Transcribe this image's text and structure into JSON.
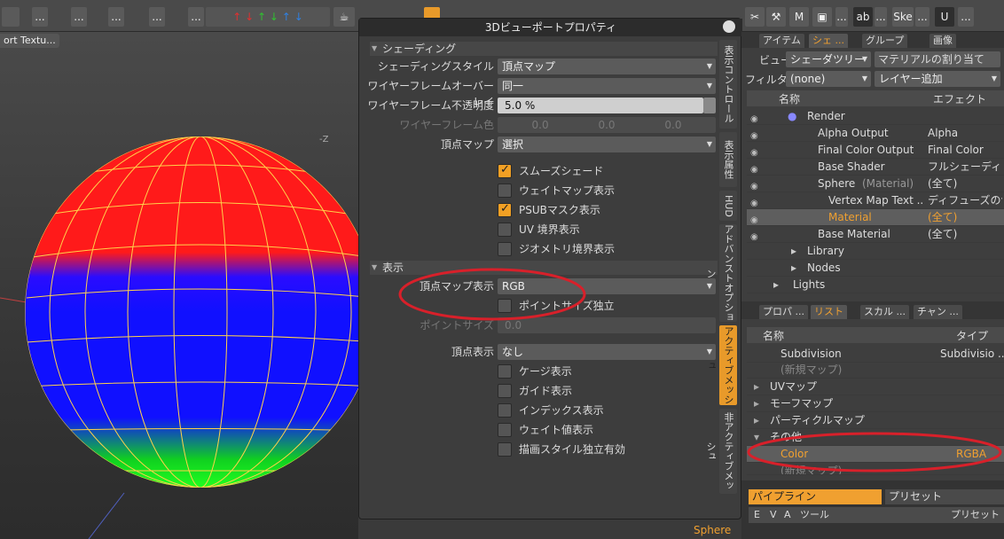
{
  "toolbar": {
    "items": [
      "...",
      "...",
      "...",
      "...",
      "...",
      "...",
      "...",
      "Ske",
      "..."
    ],
    "ab_label": "ab"
  },
  "viewport": {
    "label": "ort Textu...",
    "axis_label": "-Z",
    "status": "Sphere"
  },
  "dialog": {
    "title": "3Dビューポートプロパティ",
    "sec_shading": "シェーディング",
    "shading_style_label": "シェーディングスタイル",
    "shading_style_value": "頂点マップ",
    "wire_overlay_label": "ワイヤーフレームオーバーレイ",
    "wire_overlay_value": "同一",
    "wire_opacity_label": "ワイヤーフレーム不透明度",
    "wire_opacity_value": "5.0 %",
    "wire_color_label": "ワイヤーフレーム色",
    "wire_color_values": [
      "0.0",
      "0.0",
      "0.0"
    ],
    "vmap_label": "頂点マップ",
    "vmap_value": "選択",
    "checks": [
      {
        "label": "スムーズシェード",
        "checked": true
      },
      {
        "label": "ウェイトマップ表示",
        "checked": false
      },
      {
        "label": "PSUBマスク表示",
        "checked": true
      },
      {
        "label": "UV 境界表示",
        "checked": false
      },
      {
        "label": "ジオメトリ境界表示",
        "checked": false
      }
    ],
    "sec_display": "表示",
    "vmap_display_label": "頂点マップ表示",
    "vmap_display_value": "RGB",
    "point_size_indep": "ポイントサイズ独立",
    "point_size_label": "ポイントサイズ",
    "point_size_value": "0.0",
    "vertex_display_label": "頂点表示",
    "vertex_display_value": "なし",
    "checks2": [
      "ケージ表示",
      "ガイド表示",
      "インデックス表示",
      "ウェイト値表示",
      "描画スタイル独立有効"
    ],
    "side_tabs": [
      "表示コントロール",
      "表示属性",
      "HUD",
      "アドバンストオプション",
      "アクティブメッシュ",
      "非アクティブメッシュ"
    ]
  },
  "shader": {
    "tabs": [
      "アイテム",
      "シェ ...",
      "グループ",
      "画像"
    ],
    "view_label": "ビュー",
    "view_value": "シェーダツリー",
    "assign_btn": "マテリアルの割り当て",
    "filter_label": "フィルター",
    "filter_value": "(none)",
    "add_layer": "レイヤー追加",
    "col_name": "名称",
    "col_effect": "エフェクト",
    "rows": [
      {
        "name": "Render",
        "effect": ""
      },
      {
        "name": "Alpha Output",
        "effect": "Alpha"
      },
      {
        "name": "Final Color Output",
        "effect": "Final Color"
      },
      {
        "name": "Base Shader",
        "effect": "フルシェーディン..."
      },
      {
        "name": "Sphere",
        "suffix": "(Material)",
        "effect": "(全て)"
      },
      {
        "name": "Vertex Map Text ...",
        "effect": "ディフューズの色"
      },
      {
        "name": "Material",
        "effect": "(全て)"
      },
      {
        "name": "Base Material",
        "effect": "(全て)"
      },
      {
        "name": "Library",
        "effect": ""
      },
      {
        "name": "Nodes",
        "effect": ""
      },
      {
        "name": "Lights",
        "effect": ""
      }
    ]
  },
  "list": {
    "tabs": [
      "プロパ ...",
      "リスト",
      "スカル ...",
      "チャン ..."
    ],
    "col_name": "名称",
    "col_type": "タイプ",
    "rows": [
      {
        "name": "Subdivision",
        "type": "Subdivisio ..."
      },
      {
        "name": "(新規マップ)",
        "type": ""
      },
      {
        "name": "UVマップ",
        "type": ""
      },
      {
        "name": "モーフマップ",
        "type": ""
      },
      {
        "name": "パーティクルマップ",
        "type": ""
      },
      {
        "name": "その他",
        "type": ""
      },
      {
        "name": "Color",
        "type": "RGBA"
      },
      {
        "name": "(新規マップ)",
        "type": ""
      }
    ]
  },
  "pipeline": {
    "tab1": "パイプライン",
    "tab2": "プリセット",
    "cols": [
      "E",
      "V",
      "A",
      "ツール",
      "プリセット"
    ]
  },
  "colors": {
    "accent": "#f0a030",
    "annotation": "#d8202a"
  }
}
